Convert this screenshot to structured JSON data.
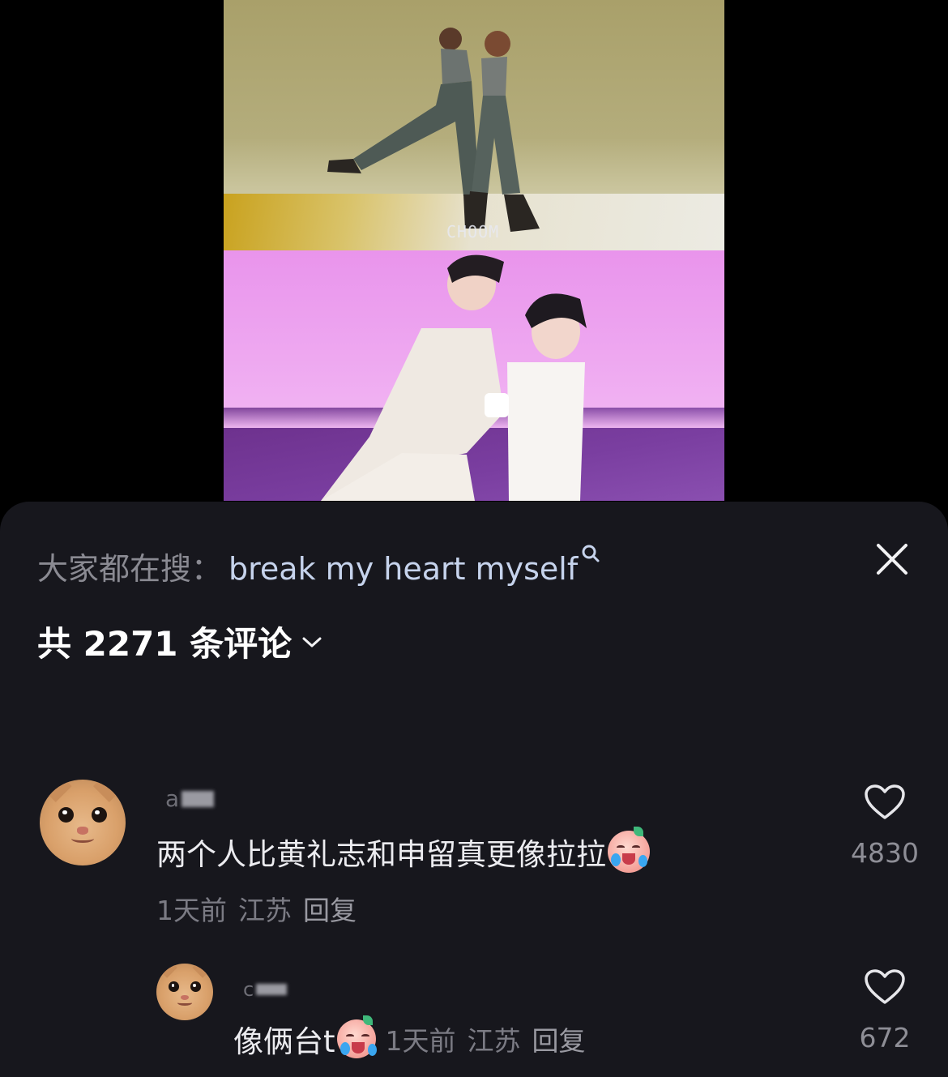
{
  "video": {
    "watermark": "CHOOM"
  },
  "comments_panel": {
    "search_prefix": "大家都在搜：",
    "search_term": "break my heart myself",
    "close_icon": "close-icon",
    "count_label": "共 2271 条评论",
    "count_icon": "chevron-down-icon",
    "comments": [
      {
        "username": "a",
        "text": "两个人比黄礼志和申留真更像拉拉",
        "emoji": "crying-face-emoji",
        "time": "1天前",
        "location": "江苏",
        "reply_label": "回复",
        "likes": "4830",
        "like_icon": "heart-icon"
      },
      {
        "username": "c",
        "text": "像俩台t",
        "emoji": "crying-face-emoji",
        "time": "1天前",
        "location": "江苏",
        "reply_label": "回复",
        "likes": "672",
        "like_icon": "heart-icon"
      }
    ]
  },
  "colors": {
    "panel_bg": "#17171d",
    "search_term": "#c6d3ec",
    "text_primary": "#ececf0",
    "text_muted": "#7b7b84"
  }
}
